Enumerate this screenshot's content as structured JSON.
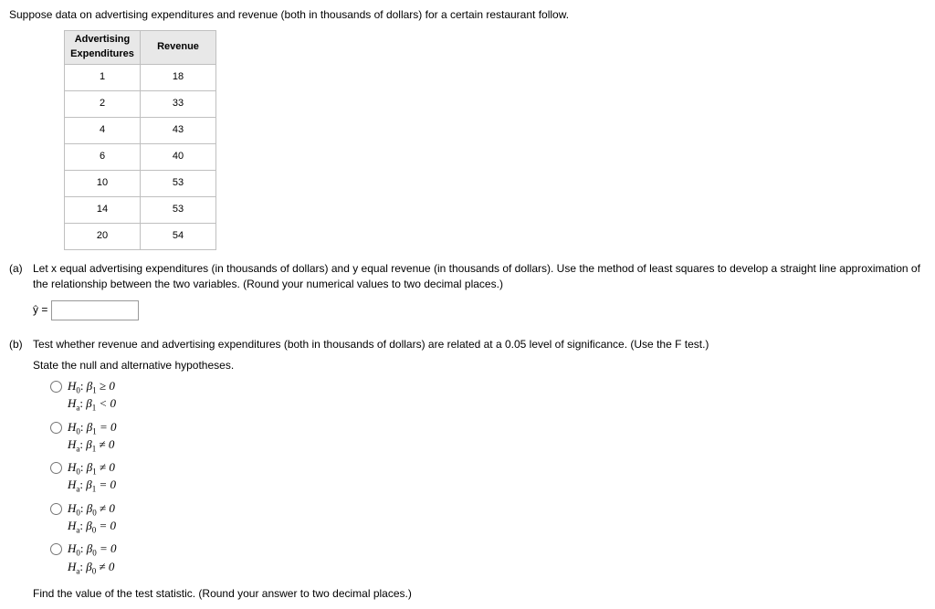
{
  "intro": "Suppose data on advertising expenditures and revenue (both in thousands of dollars) for a certain restaurant follow.",
  "chart_data": {
    "type": "table",
    "columns": [
      "Advertising Expenditures",
      "Revenue"
    ],
    "rows": [
      [
        1,
        18
      ],
      [
        2,
        33
      ],
      [
        4,
        43
      ],
      [
        6,
        40
      ],
      [
        10,
        53
      ],
      [
        14,
        53
      ],
      [
        20,
        54
      ]
    ]
  },
  "table": {
    "col1_line1": "Advertising",
    "col1_line2": "Expenditures",
    "col2": "Revenue",
    "rows": [
      {
        "a": "1",
        "r": "18"
      },
      {
        "a": "2",
        "r": "33"
      },
      {
        "a": "4",
        "r": "43"
      },
      {
        "a": "6",
        "r": "40"
      },
      {
        "a": "10",
        "r": "53"
      },
      {
        "a": "14",
        "r": "53"
      },
      {
        "a": "20",
        "r": "54"
      }
    ]
  },
  "partA": {
    "label": "(a)",
    "text": "Let x equal advertising expenditures (in thousands of dollars) and y equal revenue (in thousands of dollars). Use the method of least squares to develop a straight line approximation of the relationship between the two variables. (Round your numerical values to two decimal places.)",
    "yhat_prefix": "ŷ ="
  },
  "partB": {
    "label": "(b)",
    "text": "Test whether revenue and advertising expenditures (both in thousands of dollars) are related at a 0.05 level of significance. (Use the F test.)",
    "state": "State the null and alternative hypotheses.",
    "opts": [
      {
        "h0": "H₀: β₁ ≥ 0",
        "ha": "Hₐ: β₁ < 0"
      },
      {
        "h0": "H₀: β₁ = 0",
        "ha": "Hₐ: β₁ ≠ 0"
      },
      {
        "h0": "H₀: β₁ ≠ 0",
        "ha": "Hₐ: β₁ = 0"
      },
      {
        "h0": "H₀: β₀ ≠ 0",
        "ha": "Hₐ: β₀ = 0"
      },
      {
        "h0": "H₀: β₀ = 0",
        "ha": "Hₐ: β₀ ≠ 0"
      }
    ],
    "find": "Find the value of the test statistic. (Round your answer to two decimal places.)"
  }
}
